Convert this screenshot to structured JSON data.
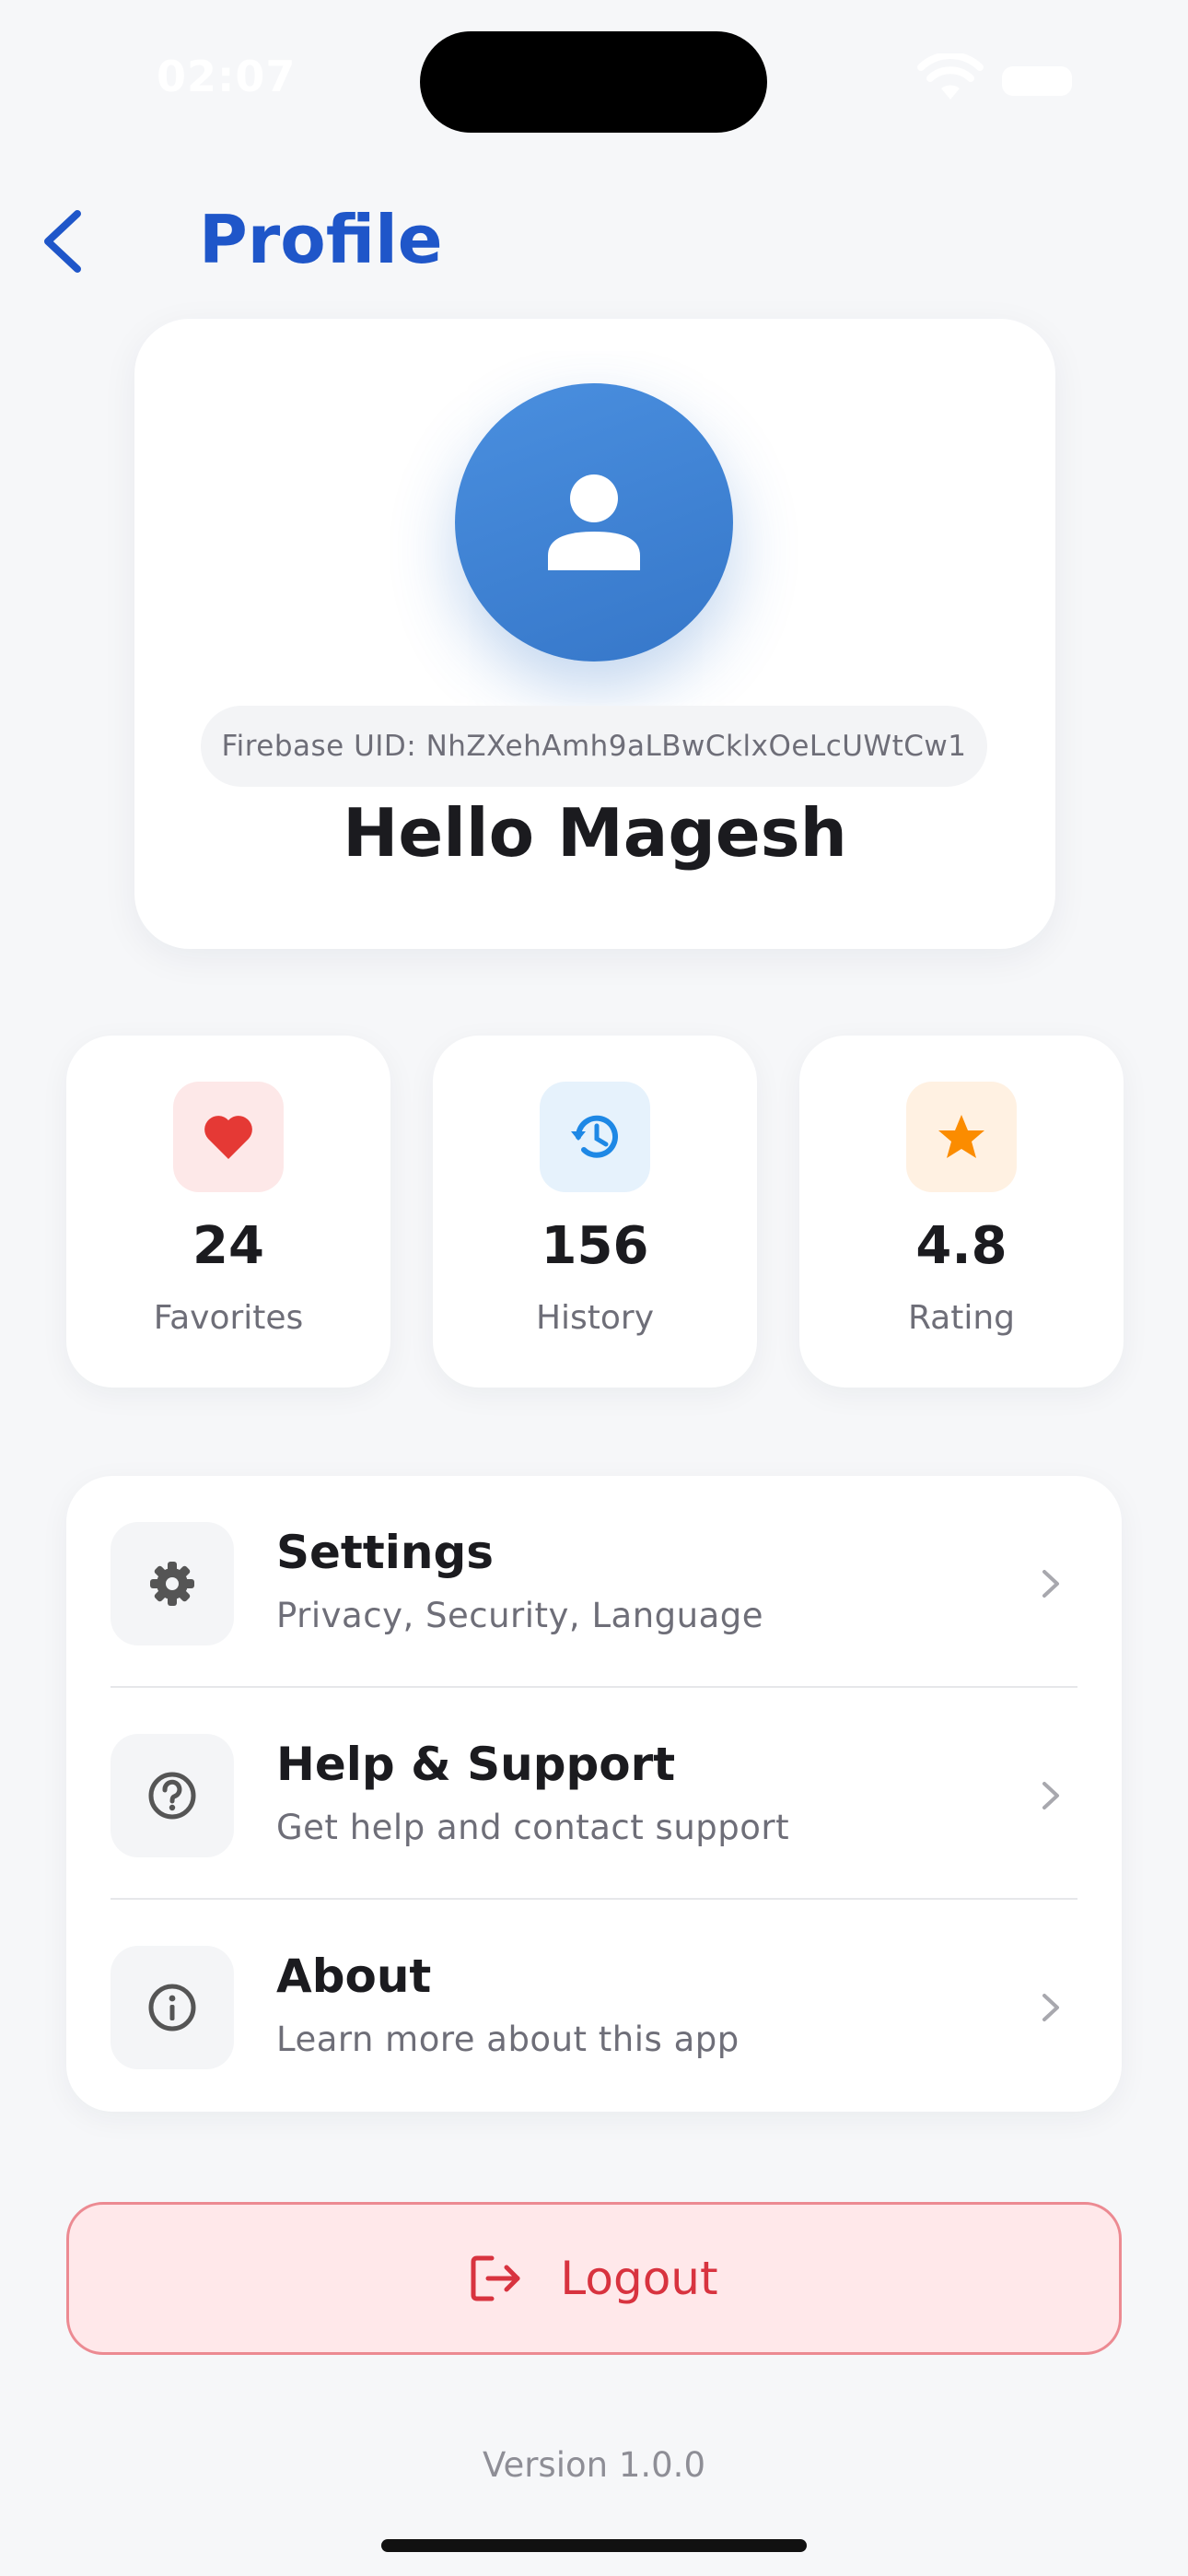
{
  "status_bar": {
    "time": "02:07"
  },
  "header": {
    "title": "Profile"
  },
  "profile": {
    "uid_text": "Firebase UID: NhZXehAmh9aLBwCklxOeLcUWtCw1",
    "greeting": "Hello Magesh"
  },
  "stats": [
    {
      "value": "24",
      "label": "Favorites",
      "icon": "heart-icon",
      "accent": "#e53935",
      "bg": "#fde8e8"
    },
    {
      "value": "156",
      "label": "History",
      "icon": "history-icon",
      "accent": "#1e88e5",
      "bg": "#e6f2fc"
    },
    {
      "value": "4.8",
      "label": "Rating",
      "icon": "star-icon",
      "accent": "#fb8c00",
      "bg": "#fff1e2"
    }
  ],
  "menu": [
    {
      "title": "Settings",
      "subtitle": "Privacy, Security, Language",
      "icon": "gear-icon"
    },
    {
      "title": "Help & Support",
      "subtitle": "Get help and contact support",
      "icon": "help-circle-icon"
    },
    {
      "title": "About",
      "subtitle": "Learn more about this app",
      "icon": "info-circle-icon"
    }
  ],
  "logout": {
    "label": "Logout",
    "icon": "logout-icon",
    "color": "#d8333f"
  },
  "footer": {
    "version": "Version 1.0.0"
  },
  "colors": {
    "primary": "#1f56c9",
    "avatar": "#3f84d6",
    "background": "#f6f7f9"
  }
}
